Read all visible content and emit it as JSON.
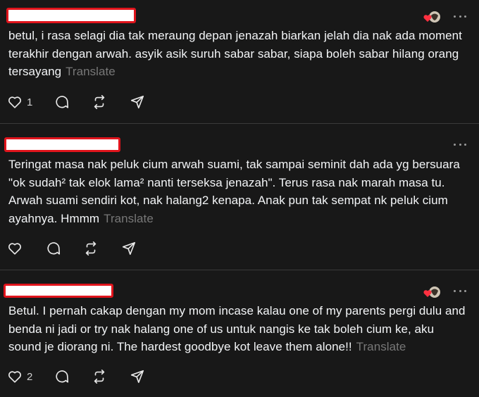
{
  "comments": [
    {
      "text": "betul, i rasa selagi dia tak meraung depan jenazah biarkan jelah dia nak ada moment terakhir dengan arwah. asyik asik suruh sabar sabar, siapa boleh sabar hilang orang tersayang",
      "translate_label": "Translate",
      "like_count": "1",
      "liked_by_author": true
    },
    {
      "text": "Teringat masa nak peluk cium arwah suami, tak sampai seminit dah ada yg bersuara \"ok sudah² tak elok lama² nanti terseksa jenazah\". Terus rasa nak marah masa tu. Arwah suami sendiri kot, nak halang2 kenapa. Anak pun tak sempat nk peluk cium ayahnya. Hmmm",
      "translate_label": "Translate",
      "like_count": "",
      "liked_by_author": false
    },
    {
      "text": "Betul. I pernah cakap dengan my mom incase kalau one of my parents pergi dulu and benda ni jadi or try nak halang one of us untuk nangis ke tak boleh cium ke, aku sound je diorang ni. The hardest goodbye kot leave them alone!!",
      "translate_label": "Translate",
      "like_count": "2",
      "liked_by_author": true
    }
  ],
  "icons": {
    "like": "heart-outline-icon",
    "reply": "speech-bubble-icon",
    "repost": "repost-arrows-icon",
    "share": "paper-plane-icon",
    "more": "ellipsis-icon",
    "liked_by_author": "heart-with-avatar-icon"
  },
  "colors": {
    "background": "#181818",
    "text": "#f3f5f7",
    "muted": "#777777",
    "redaction_border": "#e0141c",
    "heart": "#ff3040"
  }
}
